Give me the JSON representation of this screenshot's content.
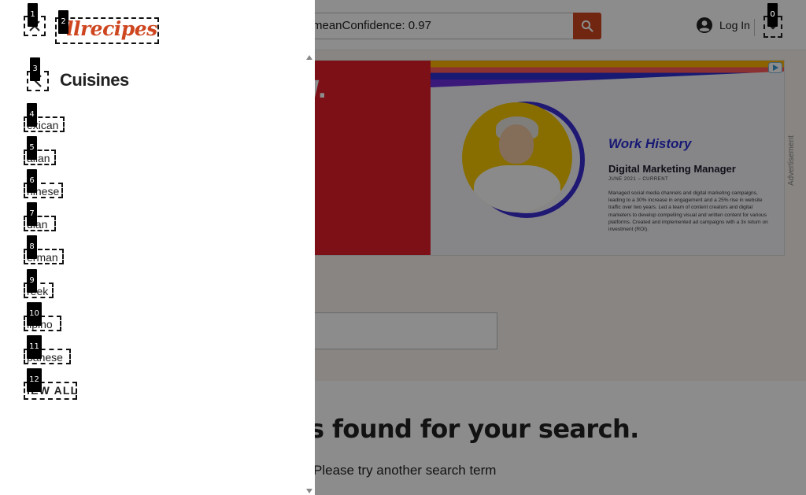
{
  "header": {
    "search_value": "meanConfidence: 0.97",
    "search_icon": "search-icon",
    "login_label": "Log In",
    "account_icon": "account-circle-icon",
    "account_toggle_icon": "chevron-down-icon"
  },
  "ad": {
    "left_word": "W.",
    "title": "Work History",
    "subtitle": "Digital Marketing Manager",
    "date": "JUNE 2021 – CURRENT",
    "body": "Managed social media channels and digital marketing campaigns, leading to a 30% increase in engagement and a 25% rise in website traffic over two years. Led a team of content creators and digital marketers to develop compelling visual and written content for various platforms. Created and implemented ad campaigns with a 3x return on investment (ROI).",
    "side_label": "Advertisement",
    "adchoices_icon": "adchoices-icon"
  },
  "results": {
    "title": "s found for your search.",
    "subtitle": "Please try another search term"
  },
  "drawer": {
    "logo_text": "llrecipes",
    "close_icon": "close-icon",
    "back_icon": "chevron-left-icon",
    "section_title": "Cuisines",
    "items": [
      {
        "label": "exican"
      },
      {
        "label": "alian"
      },
      {
        "label": "ninese"
      },
      {
        "label": "dian"
      },
      {
        "label": "erman"
      },
      {
        "label": "reek"
      },
      {
        "label": "lipino"
      },
      {
        "label": "panese"
      },
      {
        "label": "IEW ALL"
      }
    ]
  },
  "marks": [
    "0",
    "1",
    "2",
    "3",
    "4",
    "5",
    "6",
    "7",
    "8",
    "9",
    "10",
    "11",
    "12"
  ],
  "colors": {
    "brand": "#ce4620",
    "ad_red": "#e41d2b",
    "ad_blue": "#2b2fd1",
    "ad_yellow": "#f7c900",
    "scrim": "rgba(0,0,0,0.45)"
  }
}
